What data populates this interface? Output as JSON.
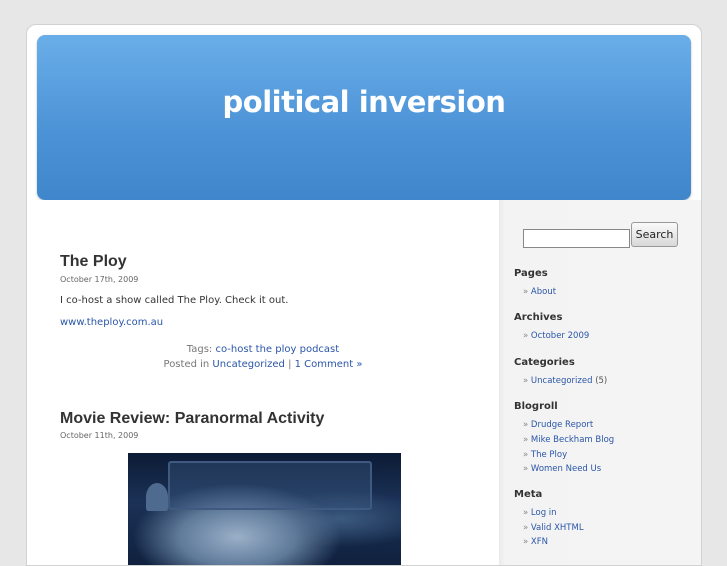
{
  "blog": {
    "title": "political inversion"
  },
  "posts": [
    {
      "title": "The Ploy",
      "date": "October 17th, 2009",
      "text": "I co-host a show called The Ploy. Check it out.",
      "link": "www.theploy.com.au",
      "tags_label": "Tags:",
      "tags": "co-host the ploy podcast",
      "posted_in_label": "Posted in",
      "category": "Uncategorized",
      "separator": "|",
      "comments": "1 Comment »"
    },
    {
      "title": "Movie Review: Paranormal Activity",
      "date": "October 11th, 2009"
    }
  ],
  "search": {
    "button_label": "Search",
    "value": ""
  },
  "sidebar": {
    "bullet": "»",
    "pages": {
      "heading": "Pages",
      "items": [
        "About"
      ]
    },
    "archives": {
      "heading": "Archives",
      "items": [
        "October 2009"
      ]
    },
    "categories": {
      "heading": "Categories",
      "item": "Uncategorized",
      "count": "(5)"
    },
    "blogroll": {
      "heading": "Blogroll",
      "items": [
        "Drudge Report",
        "Mike Beckham Blog",
        "The Ploy",
        "Women Need Us"
      ]
    },
    "meta": {
      "heading": "Meta",
      "items": [
        "Log in",
        "Valid XHTML",
        "XFN"
      ]
    }
  }
}
